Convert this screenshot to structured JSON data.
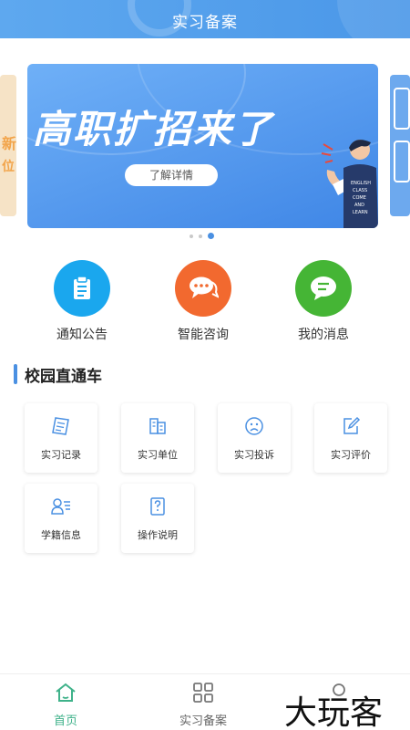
{
  "header": {
    "title": "实习备案"
  },
  "banner": {
    "headline": "高职扩招来了",
    "cta": "了解详情",
    "left_card_lines": [
      "新",
      "位"
    ],
    "person_shirt_text": "ENGLISH CLASS COME AND LEARN",
    "active_slide": 3,
    "slide_count": 3
  },
  "quick_actions": [
    {
      "label": "通知公告",
      "icon": "clipboard-icon",
      "color": "#1aa7ee"
    },
    {
      "label": "智能咨询",
      "icon": "chat-bubbles-icon",
      "color": "#f2692f"
    },
    {
      "label": "我的消息",
      "icon": "message-icon",
      "color": "#45b535"
    }
  ],
  "section": {
    "title": "校园直通车"
  },
  "grid": [
    {
      "label": "实习记录",
      "icon": "notebook-icon"
    },
    {
      "label": "实习单位",
      "icon": "building-icon"
    },
    {
      "label": "实习投诉",
      "icon": "sad-face-icon"
    },
    {
      "label": "实习评价",
      "icon": "edit-icon"
    },
    {
      "label": "学籍信息",
      "icon": "id-card-icon"
    },
    {
      "label": "操作说明",
      "icon": "help-document-icon"
    }
  ],
  "bottom_nav": [
    {
      "label": "首页",
      "icon": "home-icon",
      "active": true
    },
    {
      "label": "实习备案",
      "icon": "grid-icon",
      "active": false
    },
    {
      "label": "",
      "icon": "user-icon",
      "active": false
    }
  ],
  "watermark": "大玩客",
  "colors": {
    "accent": "#4a90e2",
    "active_nav": "#3fb28a",
    "header": "#5ea8ef"
  }
}
